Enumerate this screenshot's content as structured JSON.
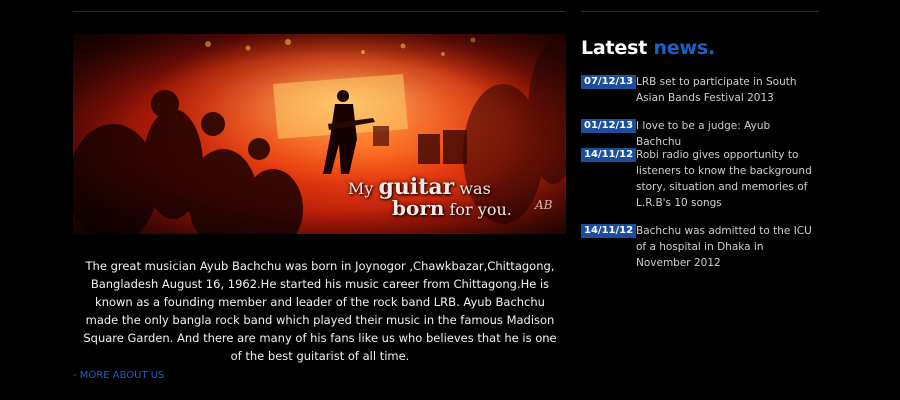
{
  "hero": {
    "tagline_part1": "My",
    "tagline_part2": "guitar",
    "tagline_part3": "was",
    "tagline_part4": "born",
    "tagline_part5": "for you.",
    "signature": "AB"
  },
  "about": {
    "text": "The great musician Ayub Bachchu was born in Joynogor ,Chawkbazar,Chittagong, Bangladesh August 16, 1962.He started his music career from Chittagong.He is known as a founding member and leader of the rock band LRB. Ayub Bachchu made the only bangla rock band which played their music in the famous Madison Square Garden. And there are many of his fans like us who believes that he is one of the best guitarist of all time.",
    "more_link": "- MORE ABOUT US"
  },
  "news": {
    "title_word1": "Latest",
    "title_word2": "news.",
    "items": [
      {
        "date": "07/12/13",
        "text": "LRB set to participate in South Asian Bands Festival 2013"
      },
      {
        "date": "01/12/13",
        "text": "I love to be a judge: Ayub Bachchu"
      },
      {
        "date": "14/11/12",
        "text": "Robi radio gives opportunity to listeners to know the background story, situation and memories of L.R.B's 10 songs"
      },
      {
        "date": "14/11/12",
        "text": "Bachchu was admitted to the ICU of a hospital in Dhaka in November 2012"
      }
    ]
  },
  "colors": {
    "background": "#000000",
    "accent_blue": "#1a60c6",
    "date_badge": "#1b4f9c"
  }
}
